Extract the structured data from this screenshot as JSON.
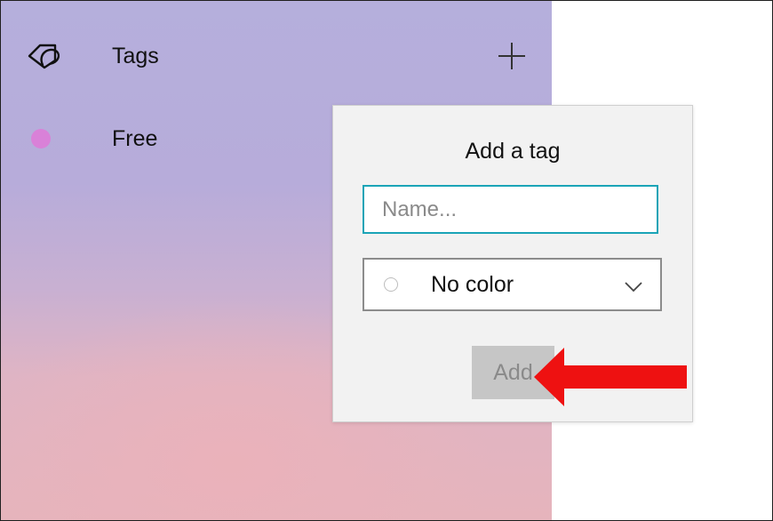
{
  "sidebar": {
    "tags_label": "Tags",
    "tags_icon": "tag-icon",
    "add_icon": "plus-icon",
    "items": [
      {
        "label": "Free",
        "color": "#d981d8"
      }
    ]
  },
  "popup": {
    "title": "Add a tag",
    "name_placeholder": "Name...",
    "color_value": "No color",
    "add_label": "Add"
  },
  "colors": {
    "input_focus_border": "#1aa4b7",
    "annotation_arrow": "#ee1111",
    "add_button_bg": "#c6c6c6"
  }
}
